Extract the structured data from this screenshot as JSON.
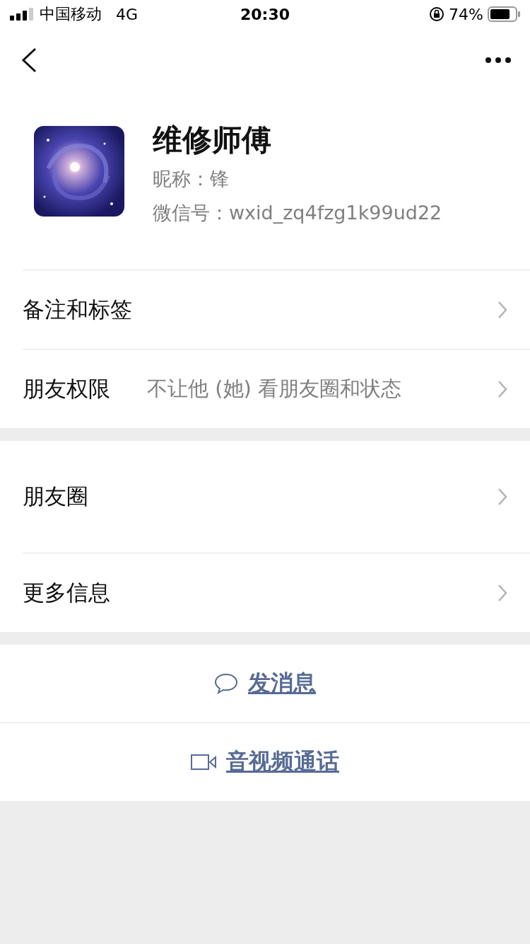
{
  "status_bar": {
    "carrier": "中国移动",
    "network": "4G",
    "time": "20:30",
    "battery": "74%"
  },
  "profile": {
    "name": "维修师傅",
    "nickname": "昵称：锋",
    "wechat_id": "微信号：wxid_zq4fzg1k99ud22"
  },
  "sections": [
    {
      "rows": [
        {
          "kind": "link",
          "label": "备注和标签"
        },
        {
          "kind": "link",
          "label": "朋友权限",
          "value": "不让他 (她) 看朋友圈和状态"
        }
      ]
    },
    {
      "rows": [
        {
          "kind": "feed",
          "label": "朋友圈"
        },
        {
          "kind": "link",
          "label": "更多信息"
        }
      ]
    }
  ],
  "actions": [
    {
      "kind": "message",
      "label": "发消息"
    },
    {
      "kind": "video",
      "label": "音视频通话"
    }
  ]
}
